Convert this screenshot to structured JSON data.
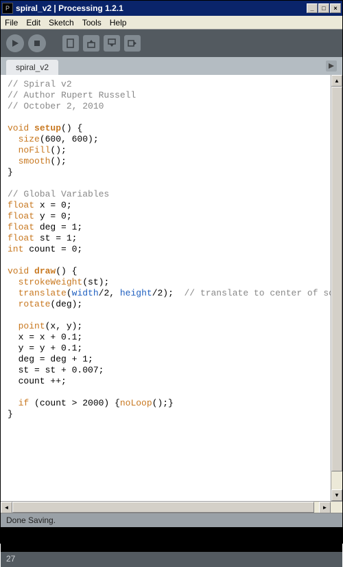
{
  "window": {
    "title": "spiral_v2 | Processing 1.2.1"
  },
  "menu": [
    "File",
    "Edit",
    "Sketch",
    "Tools",
    "Help"
  ],
  "tab": {
    "name": "spiral_v2"
  },
  "status": {
    "text": "Done Saving."
  },
  "footer": {
    "line": "27"
  },
  "code": {
    "c1": "// Spiral v2",
    "c2": "// Author Rupert Russell",
    "c3": "// October 2, 2010",
    "void": "void",
    "setup": "setup",
    "draw": "draw",
    "size": "size",
    "sizeArgs": "(600, 600);",
    "noFill": "noFill",
    "smooth": "smooth",
    "emptyCall": "();",
    "openParen": "() {",
    "closeBrace": "}",
    "cGlobal": "// Global Variables",
    "float": "float",
    "int": "int",
    "x0": " x = 0;",
    "y0": " y = 0;",
    "deg1": " deg = 1;",
    "st1": " st = 1;",
    "count0": " count = 0;",
    "strokeWeight": "strokeWeight",
    "swArgs": "(st);",
    "translate": "translate",
    "width": "width",
    "height": "height",
    "transMid": "/2, ",
    "transEnd": "/2);  ",
    "transComment": "// translate to center of screen",
    "rotate": "rotate",
    "rotArgs": "(deg);",
    "point": "point",
    "pointArgs": "(x, y);",
    "xInc": "  x = x + 0.1;",
    "yInc": "  y = y + 0.1;",
    "degInc": "  deg = deg + 1;",
    "stInc": "  st = st + 0.007;",
    "countInc": "  count ++;",
    "if": "if",
    "ifCond": " (count > 2000) {",
    "noLoop": "noLoop",
    "noLoopEnd": "();}",
    "openTr": "("
  }
}
